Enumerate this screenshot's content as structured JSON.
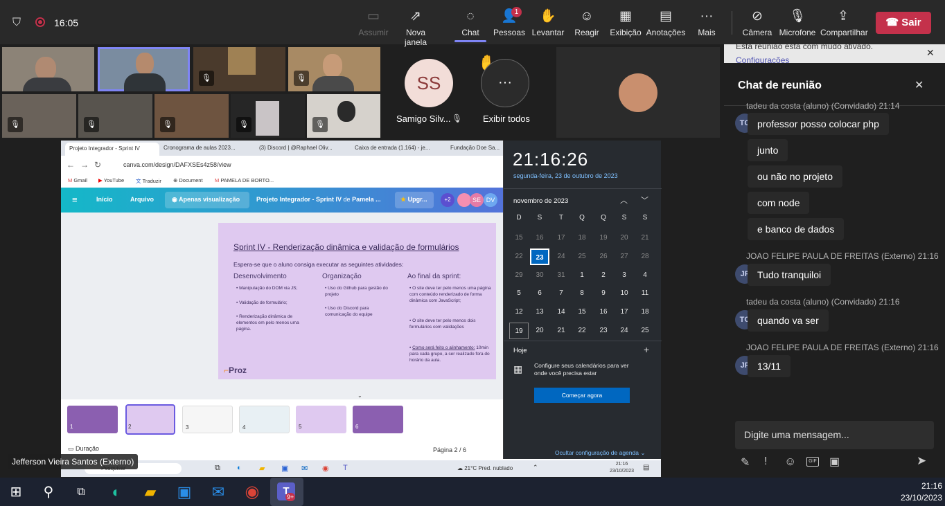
{
  "topbar": {
    "shield_icon": "shield-icon",
    "record_icon": "record-icon",
    "time": "16:05",
    "buttons": [
      {
        "label": "Assumir",
        "icon": "assume-control-icon",
        "disabled": true
      },
      {
        "label": "Nova janela",
        "icon": "new-window-icon"
      },
      {
        "label": "Chat",
        "icon": "chat-icon",
        "active": true
      },
      {
        "label": "Pessoas",
        "icon": "people-icon",
        "badge": "1"
      },
      {
        "label": "Levantar",
        "icon": "raise-hand-icon"
      },
      {
        "label": "Reagir",
        "icon": "react-icon"
      },
      {
        "label": "Exibição",
        "icon": "layout-icon"
      },
      {
        "label": "Anotações",
        "icon": "notes-icon"
      },
      {
        "label": "Mais",
        "icon": "more-icon"
      },
      {
        "label": "Câmera",
        "icon": "camera-off-icon"
      },
      {
        "label": "Microfone",
        "icon": "mic-off-icon"
      },
      {
        "label": "Compartilhar",
        "icon": "share-icon"
      }
    ],
    "leave_label": "Sair"
  },
  "participants": {
    "ss_initials": "SS",
    "ss_name": "Samigo Silv...",
    "show_all": "Exibir todos",
    "presenter_name": "Jefferson Vieira Santos (Externo)"
  },
  "browser": {
    "tabs": [
      "Projeto Integrador - Sprint IV",
      "Cronograma de aulas 2023...",
      "(3) Discord | @Raphael Oliv...",
      "Caixa de entrada (1.164) - je...",
      "Fundação Doe Sa..."
    ],
    "url": "canva.com/design/DAFXSEs4z58/view",
    "bookmarks": [
      "Gmail",
      "YouTube",
      "Traduzir",
      "Document",
      "PAMELA DE BORTO..."
    ]
  },
  "canva": {
    "menu": [
      "Início",
      "Arquivo"
    ],
    "view_mode": "Apenas visualização",
    "doc_title": "Projeto Integrador - Sprint IV",
    "doc_by": "de",
    "doc_author": "Pamela ...",
    "upgrade": "Upgr...",
    "collab_count": "+2",
    "collab_initials": [
      "SE",
      "DV"
    ],
    "slide": {
      "title": "Sprint IV - Renderização dinâmica e validação de formulários",
      "intro": "Espera-se que o aluno consiga executar as seguintes atividades:",
      "col1_title": "Desenvolvimento",
      "col1_items": [
        "Manipulação do DOM via JS;",
        "Validação de formulário;",
        "Renderização dinâmica de elementos em pelo menos uma página."
      ],
      "col2_title": "Organização",
      "col2_items": [
        "Uso do Github para gestão do projeto",
        "Uso do Discord para comunicação do equipe"
      ],
      "col3_title": "Ao final da sprint:",
      "col3_items": [
        "O site deve ter pelo menos uma página com conteúdo renderizado de forma dinâmica com JavaScript;",
        "O site deve ter pelo menos dois formulários com validações"
      ],
      "col3_link": "Como será feito o alinhamento:",
      "col3_link_rest": "10min para cada grupo, a ser realizado fora do horário da aula.",
      "brand": "Proz"
    },
    "thumbs": [
      "1",
      "2",
      "3",
      "4",
      "5",
      "6"
    ],
    "duration": "Duração",
    "page": "Página 2 / 6"
  },
  "calendar": {
    "time": "21:16:26",
    "date": "segunda-feira, 23 de outubro de 2023",
    "month": "novembro de 2023",
    "weekdays": [
      "D",
      "S",
      "T",
      "Q",
      "Q",
      "S",
      "S"
    ],
    "days": [
      "15",
      "16",
      "17",
      "18",
      "19",
      "20",
      "21",
      "22",
      "23",
      "24",
      "25",
      "26",
      "27",
      "28",
      "29",
      "30",
      "31",
      "1",
      "2",
      "3",
      "4",
      "5",
      "6",
      "7",
      "8",
      "9",
      "10",
      "11",
      "12",
      "13",
      "14",
      "15",
      "16",
      "17",
      "18",
      "19",
      "20",
      "21",
      "22",
      "23",
      "24",
      "25"
    ],
    "today_label": "Hoje",
    "empty_text": "Configure seus calendários para ver onde você precisa estar",
    "start_button": "Começar agora",
    "hide_link": "Ocultar configuração de agenda"
  },
  "inner_taskbar": {
    "search": "Pesquisar",
    "weather": "21°C  Pred. nublado",
    "time": "21:16",
    "date": "23/10/2023"
  },
  "chat": {
    "notice": "Esta reunião está com mudo ativado.",
    "notice_link": "Configurações",
    "title": "Chat de reunião",
    "messages": [
      {
        "author": "tadeu da costa (aluno) (Convidado)",
        "time": "21:14",
        "initials": "TC",
        "lines": [
          "professor posso colocar php",
          "junto",
          "ou não no projeto",
          "com node",
          "e banco de dados"
        ]
      },
      {
        "author": "JOAO FELIPE PAULA DE FREITAS (Externo)",
        "time": "21:16",
        "initials": "JF",
        "lines": [
          "Tudo tranquiloi"
        ]
      },
      {
        "author": "tadeu da costa (aluno) (Convidado)",
        "time": "21:16",
        "initials": "TC",
        "lines": [
          "quando va ser"
        ]
      },
      {
        "author": "JOAO FELIPE PAULA DE FREITAS (Externo)",
        "time": "21:16",
        "initials": "JF",
        "lines": [
          "13/11"
        ]
      }
    ],
    "input_placeholder": "Digite uma mensagem..."
  },
  "taskbar": {
    "time": "21:16",
    "date": "23/10/2023",
    "teams_badge": "9+"
  }
}
